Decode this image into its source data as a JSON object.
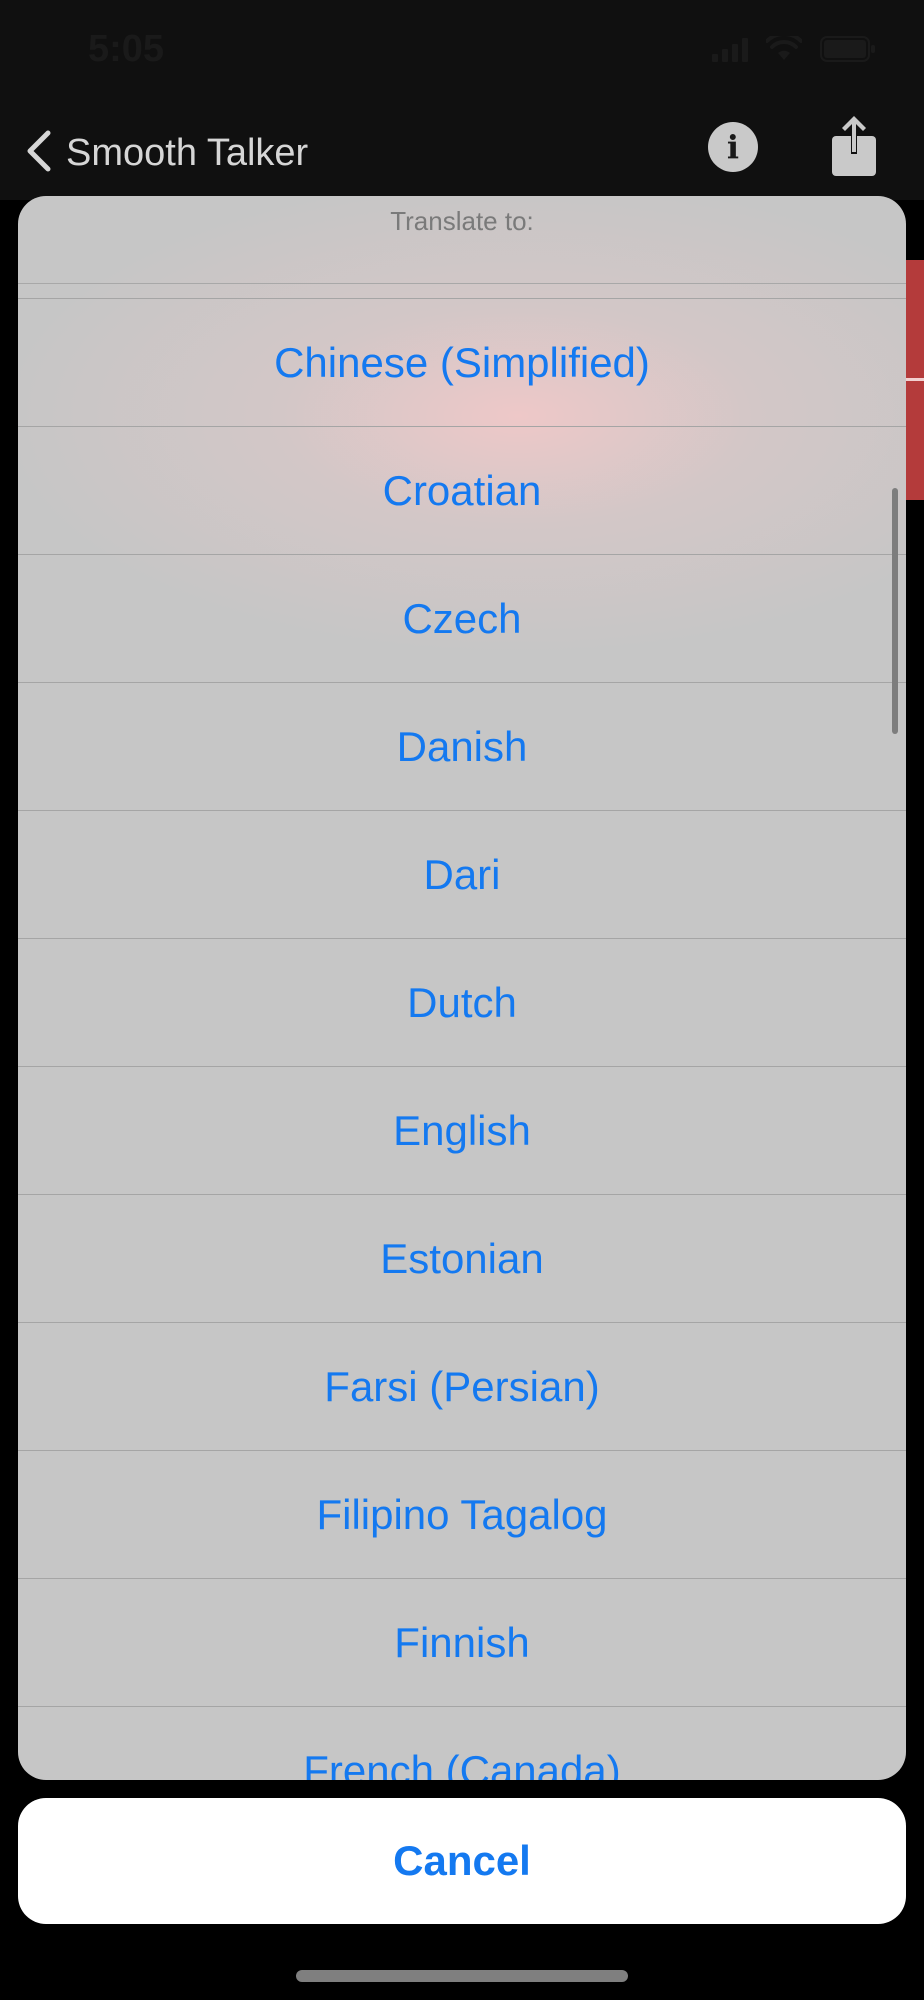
{
  "status_bar": {
    "time": "5:05"
  },
  "nav": {
    "back_label": "Smooth Talker",
    "info_glyph": "i"
  },
  "sheet": {
    "title": "Translate to:",
    "options": [
      "Chinese (Simplified)",
      "Croatian",
      "Czech",
      "Danish",
      "Dari",
      "Dutch",
      "English",
      "Estonian",
      "Farsi (Persian)",
      "Filipino Tagalog",
      "Finnish",
      "French (Canada)"
    ],
    "cancel_label": "Cancel"
  },
  "icons": {
    "back": "chevron-left-icon",
    "info": "info-icon",
    "share": "share-icon",
    "wifi": "wifi-icon",
    "battery": "battery-icon",
    "signal": "signal-icon"
  },
  "colors": {
    "accent": "#1479f0",
    "sheet_background": "#c6c6c6",
    "nav_background": "#101010",
    "background_accent": "#b43b3b"
  }
}
